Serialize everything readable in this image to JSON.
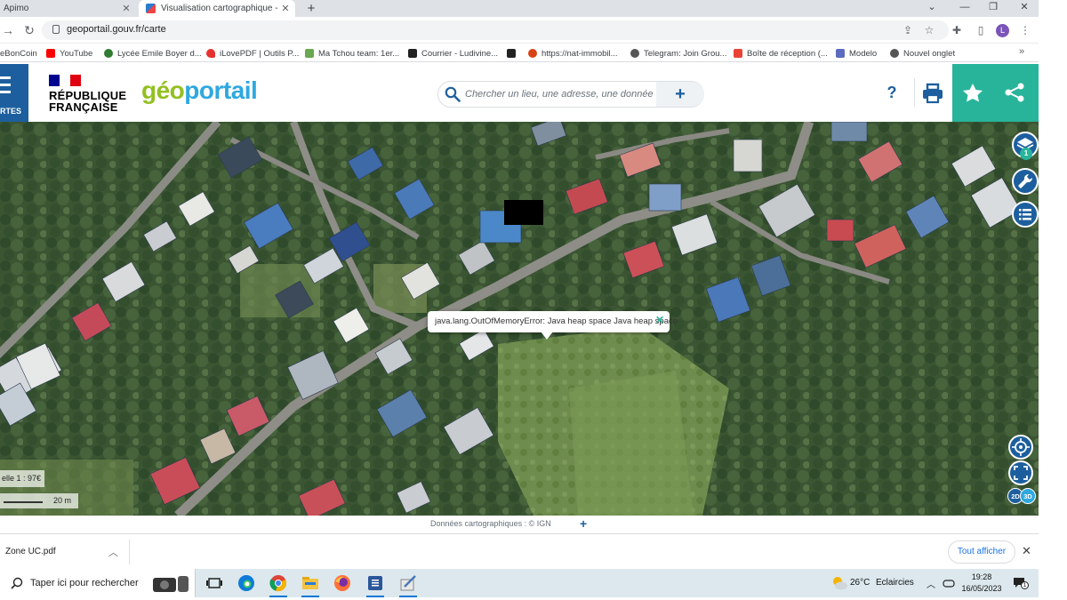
{
  "browser": {
    "tabs": [
      {
        "title": "Apimo",
        "active": false
      },
      {
        "title": "Visualisation cartographique - G",
        "active": true
      }
    ],
    "new_tab": "+",
    "url": "geoportail.gouv.fr/carte",
    "profile_initial": "L",
    "bookmarks": [
      {
        "label": "eBonCoin",
        "color": "#f56b2a"
      },
      {
        "label": "YouTube",
        "color": "#ff0000"
      },
      {
        "label": "Lycée Emile Boyer d...",
        "color": "#2e7d32"
      },
      {
        "label": "iLovePDF | Outils P...",
        "color": "#e5322d"
      },
      {
        "label": "Ma Tchou team: 1er...",
        "color": "#6aa84f"
      },
      {
        "label": "Courrier - Ludivine...",
        "color": "#222222"
      },
      {
        "label": "",
        "color": "#222222"
      },
      {
        "label": "https://nat-immobil...",
        "color": "#d84315"
      },
      {
        "label": "Telegram: Join Grou...",
        "color": "#555555"
      },
      {
        "label": "Boîte de réception (...",
        "color": "#ea4335"
      },
      {
        "label": "Modelo",
        "color": "#5c6bc0"
      },
      {
        "label": "Nouvel onglet",
        "color": "#555555"
      }
    ]
  },
  "geoportail": {
    "menu_label": "RTES",
    "rf_line1": "RÉPUBLIQUE",
    "rf_line2": "FRANÇAISE",
    "logo_geo": "géo",
    "logo_portail": "portail",
    "search_placeholder": "Chercher un lieu, une adresse, une donnée",
    "search_add": "+",
    "help_label": "?",
    "popup_text": "java.lang.OutOfMemoryError: Java heap space Java heap space",
    "popup_close": "✕",
    "layer_count": "1",
    "scale_text": "elle 1 : 97€",
    "scalebar_text": "20 m",
    "toggle_2d": "2D",
    "toggle_3d": "3D",
    "attribution_text": "Données cartographiques : ©      IGN",
    "attribution_plus": "+"
  },
  "downloads": {
    "file_name": "Zone UC.pdf",
    "show_all": "Tout afficher",
    "close": "✕"
  },
  "taskbar": {
    "search_placeholder": "Taper ici pour rechercher",
    "weather_temp": "26°C",
    "weather_text": "Eclaircies",
    "time": "19:28",
    "date": "16/05/2023",
    "notifications": "1"
  },
  "colors": {
    "gp_blue": "#1d5f9e",
    "gp_teal": "#27b49a",
    "gp_logo_blue": "#2fa8df",
    "gp_logo_green": "#93c021"
  }
}
